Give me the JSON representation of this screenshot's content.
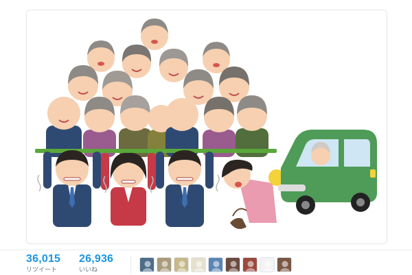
{
  "tweet": {
    "image": {
      "icon": "illustration-elderly-crowd-carried-by-workers-icon",
      "colors": {
        "suit": "#2f4a72",
        "skin": "#f6d0b0",
        "hair_gray": "#8e8a86",
        "hair_dark": "#2b2522",
        "board": "#5aa83a",
        "car": "#4e9c57",
        "woman_dress": "#ea9bb0"
      }
    },
    "stats": {
      "retweets": {
        "count": "36,015",
        "label": "リツイート"
      },
      "likes": {
        "count": "26,936",
        "label": "いいね"
      }
    },
    "likers": [
      {
        "icon": "avatar-1-icon",
        "color": "#4d6d8a"
      },
      {
        "icon": "avatar-2-icon",
        "color": "#a99b7b"
      },
      {
        "icon": "avatar-3-icon",
        "color": "#c6b98a"
      },
      {
        "icon": "avatar-4-icon",
        "color": "#e7e0cf"
      },
      {
        "icon": "avatar-5-icon",
        "color": "#5b86b3"
      },
      {
        "icon": "avatar-6-icon",
        "color": "#6a4b3e"
      },
      {
        "icon": "avatar-7-icon",
        "color": "#9a4a3c"
      },
      {
        "icon": "avatar-8-icon",
        "color": "#f3f3f3"
      },
      {
        "icon": "avatar-9-icon",
        "color": "#7a5846"
      }
    ]
  }
}
